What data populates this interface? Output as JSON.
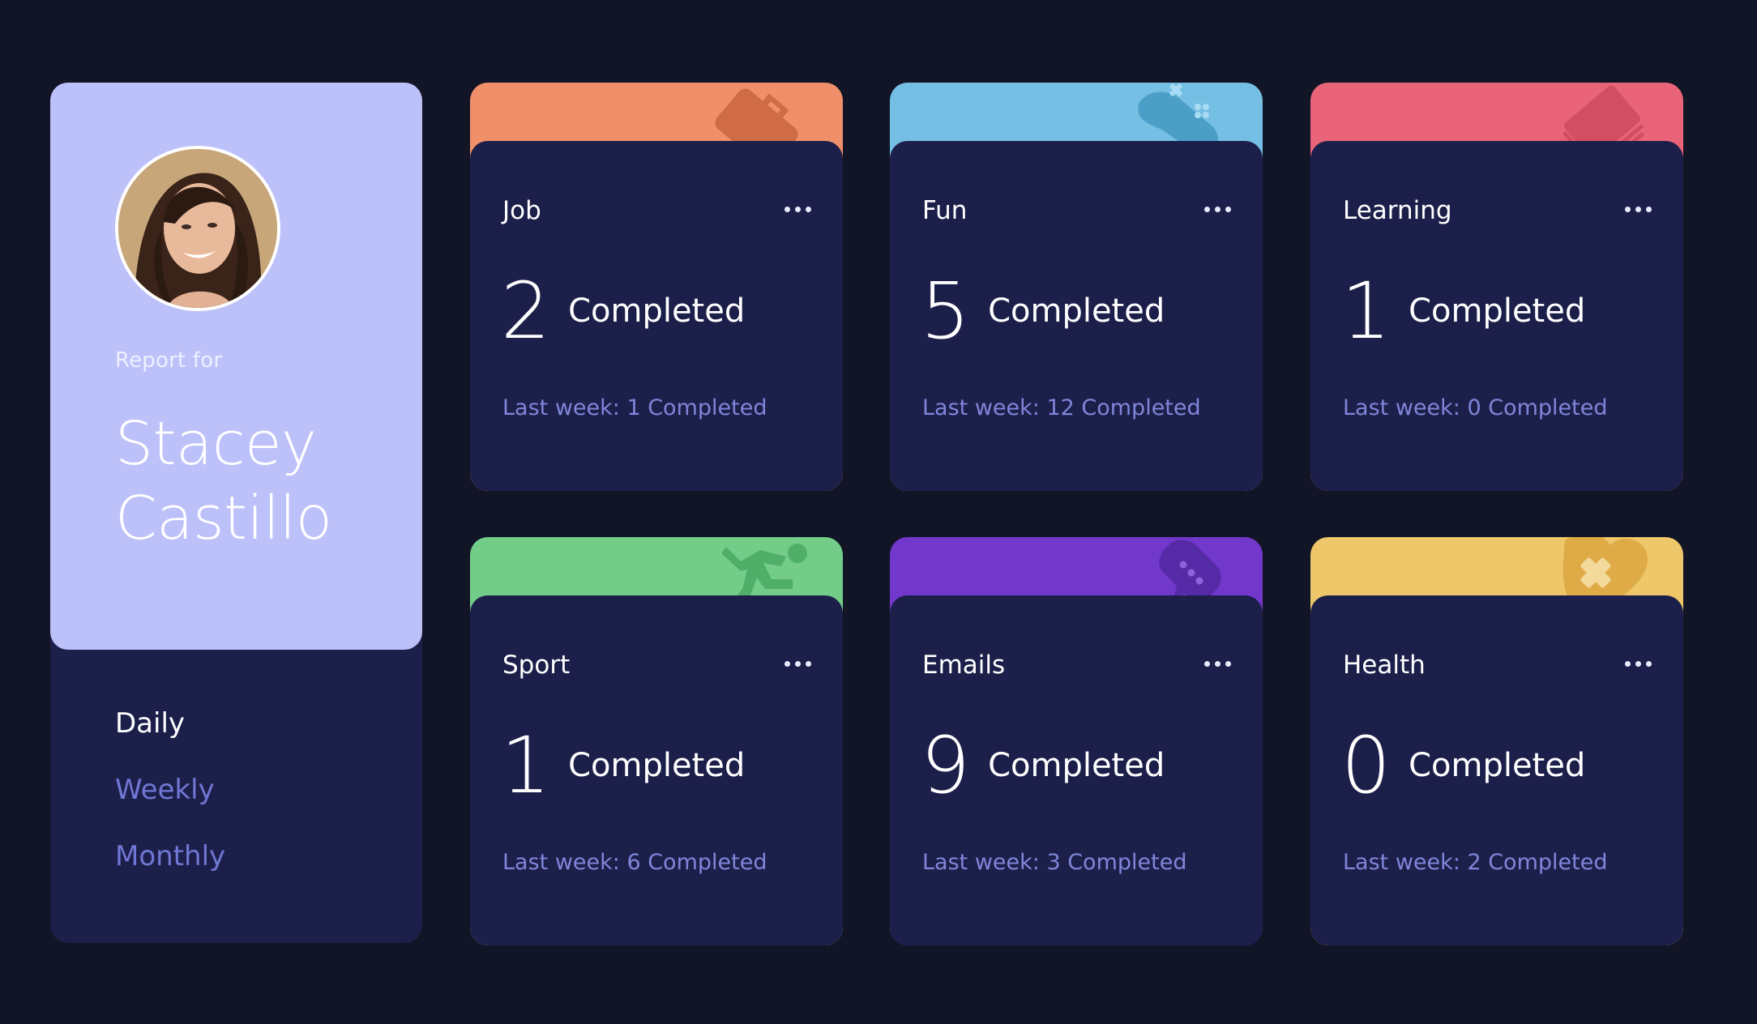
{
  "profile": {
    "report_for": "Report for",
    "first_name": "Stacey",
    "last_name": "Castillo",
    "colors": {
      "top": "#bdc1fa",
      "bottom": "#1c1f4a"
    }
  },
  "periods": [
    {
      "label": "Daily",
      "active": true
    },
    {
      "label": "Weekly",
      "active": false
    },
    {
      "label": "Monthly",
      "active": false
    }
  ],
  "activities": [
    {
      "title": "Job",
      "count": "2",
      "count_label": "Completed",
      "last_week": "Last week: 1 Completed",
      "color": "#f0906a",
      "icon": "briefcase-icon"
    },
    {
      "title": "Fun",
      "count": "5",
      "count_label": "Completed",
      "last_week": "Last week: 12 Completed",
      "color": "#76bfe4",
      "icon": "gamepad-icon"
    },
    {
      "title": "Learning",
      "count": "1",
      "count_label": "Completed",
      "last_week": "Last week: 0 Completed",
      "color": "#ea6479",
      "icon": "book-icon"
    },
    {
      "title": "Sport",
      "count": "1",
      "count_label": "Completed",
      "last_week": "Last week: 6 Completed",
      "color": "#73cd89",
      "icon": "runner-icon"
    },
    {
      "title": "Emails",
      "count": "9",
      "count_label": "Completed",
      "last_week": "Last week: 3 Completed",
      "color": "#7238cc",
      "icon": "chat-icon"
    },
    {
      "title": "Health",
      "count": "0",
      "count_label": "Completed",
      "last_week": "Last week: 2 Completed",
      "color": "#edc76a",
      "icon": "heart-icon"
    }
  ]
}
